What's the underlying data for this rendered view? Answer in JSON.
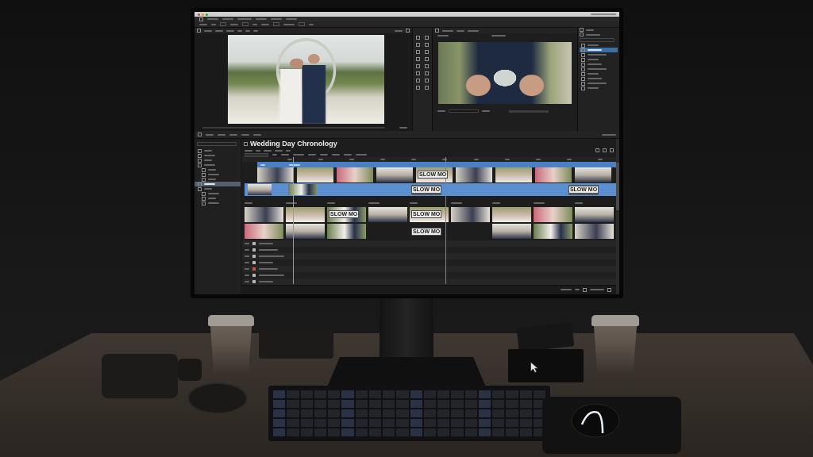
{
  "editor": {
    "inspector": {
      "items": [
        {
          "selected": false
        },
        {
          "selected": true
        },
        {
          "selected": false
        },
        {
          "selected": false
        },
        {
          "selected": false
        },
        {
          "selected": false
        },
        {
          "selected": false
        },
        {
          "selected": false
        },
        {
          "selected": false
        },
        {
          "selected": false
        }
      ]
    },
    "sidebar": {
      "items": [
        {
          "selected": false
        },
        {
          "selected": false
        },
        {
          "selected": false
        },
        {
          "selected": false
        },
        {
          "selected": false
        },
        {
          "selected": false
        },
        {
          "selected": false
        },
        {
          "selected": true
        },
        {
          "selected": false
        },
        {
          "selected": false
        },
        {
          "selected": false
        },
        {
          "selected": false
        }
      ]
    },
    "timeline": {
      "title": "Wedding Day Chronology",
      "tracks": [
        {
          "clips": [
            {
              "kind": "photo"
            },
            {
              "kind": "photo"
            },
            {
              "kind": "photo"
            },
            {
              "kind": "photo"
            },
            {
              "kind": "slow_mo",
              "label": "SLOW MO"
            },
            {
              "kind": "photo"
            },
            {
              "kind": "photo"
            },
            {
              "kind": "photo"
            },
            {
              "kind": "photo"
            }
          ]
        },
        {
          "clips": [
            {
              "kind": "photo"
            },
            {
              "kind": "photo"
            },
            {
              "kind": "badge",
              "label": "SLOW MO"
            },
            {
              "kind": "badge",
              "label": "SLOW MO"
            }
          ]
        }
      ],
      "bins": [
        {
          "clips": [
            {
              "kind": "photo"
            },
            {
              "kind": "photo"
            }
          ]
        },
        {
          "clips": [
            {
              "kind": "photo"
            },
            {
              "kind": "photo"
            }
          ]
        },
        {
          "clips": [
            {
              "kind": "slow_mo",
              "label": "SLOW MO"
            },
            {
              "kind": "photo"
            }
          ]
        },
        {
          "clips": [
            {
              "kind": "photo"
            }
          ]
        },
        {
          "clips": [
            {
              "kind": "slow_mo",
              "label": "SLOW MO"
            },
            {
              "kind": "badge",
              "label": "SLOW MO"
            }
          ]
        },
        {
          "clips": [
            {
              "kind": "photo"
            }
          ]
        },
        {
          "clips": [
            {
              "kind": "photo"
            },
            {
              "kind": "photo"
            }
          ]
        },
        {
          "clips": [
            {
              "kind": "photo"
            },
            {
              "kind": "photo"
            }
          ]
        },
        {
          "clips": [
            {
              "kind": "photo"
            },
            {
              "kind": "photo"
            }
          ]
        }
      ],
      "rows": [
        {
          "color": "#b5b5b5"
        },
        {
          "color": "#b5b5b5"
        },
        {
          "color": "#b5b5b5"
        },
        {
          "color": "#b5b5b5"
        },
        {
          "color": "#c8553d"
        },
        {
          "color": "#b5b5b5"
        },
        {
          "color": "#b5b5b5"
        }
      ]
    }
  }
}
